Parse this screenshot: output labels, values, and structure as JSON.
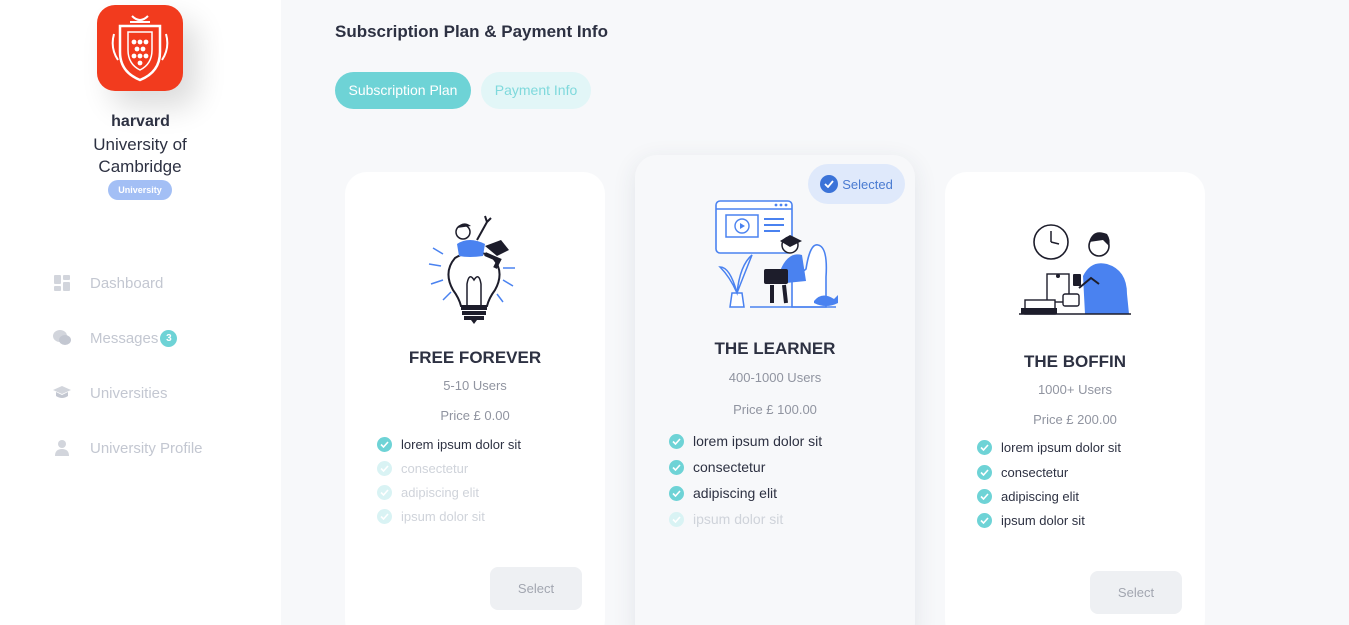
{
  "sidebar": {
    "org_name": "harvard",
    "org_subtitle": "University of Cambridge",
    "org_badge": "University",
    "nav": [
      {
        "label": "Dashboard",
        "icon": "dashboard-icon"
      },
      {
        "label": "Messages",
        "icon": "messages-icon",
        "badge": "3"
      },
      {
        "label": "Universities",
        "icon": "graduation-cap-icon"
      },
      {
        "label": "University Profile",
        "icon": "user-icon"
      }
    ]
  },
  "main": {
    "title": "Subscription Plan & Payment Info",
    "tabs": [
      {
        "label": "Subscription Plan",
        "active": true
      },
      {
        "label": "Payment Info",
        "active": false
      }
    ],
    "selected_label": "Selected",
    "plans": [
      {
        "title": "FREE FOREVER",
        "users": "5-10 Users",
        "price": "Price £ 0.00",
        "features": [
          {
            "text": "lorem ipsum dolor sit",
            "enabled": true
          },
          {
            "text": "consectetur",
            "enabled": false
          },
          {
            "text": "adipiscing elit",
            "enabled": false
          },
          {
            "text": "ipsum dolor sit",
            "enabled": false
          }
        ],
        "button": "Select"
      },
      {
        "title": "THE LEARNER",
        "users": "400-1000 Users",
        "price": "Price £ 100.00",
        "features": [
          {
            "text": "lorem ipsum dolor sit",
            "enabled": true
          },
          {
            "text": "consectetur",
            "enabled": true
          },
          {
            "text": "adipiscing elit",
            "enabled": true
          },
          {
            "text": "ipsum dolor sit",
            "enabled": false
          }
        ],
        "selected": true
      },
      {
        "title": "THE BOFFIN",
        "users": "1000+ Users",
        "price": "Price £ 200.00",
        "features": [
          {
            "text": "lorem ipsum dolor sit",
            "enabled": true
          },
          {
            "text": "consectetur",
            "enabled": true
          },
          {
            "text": "adipiscing elit",
            "enabled": true
          },
          {
            "text": "ipsum dolor sit",
            "enabled": true
          }
        ],
        "button": "Select"
      }
    ]
  },
  "colors": {
    "accent": "#6ed3d6",
    "brand_logo": "#f23b1e",
    "selected_blue": "#3b73d8",
    "illustration_blue": "#4a82f0"
  }
}
